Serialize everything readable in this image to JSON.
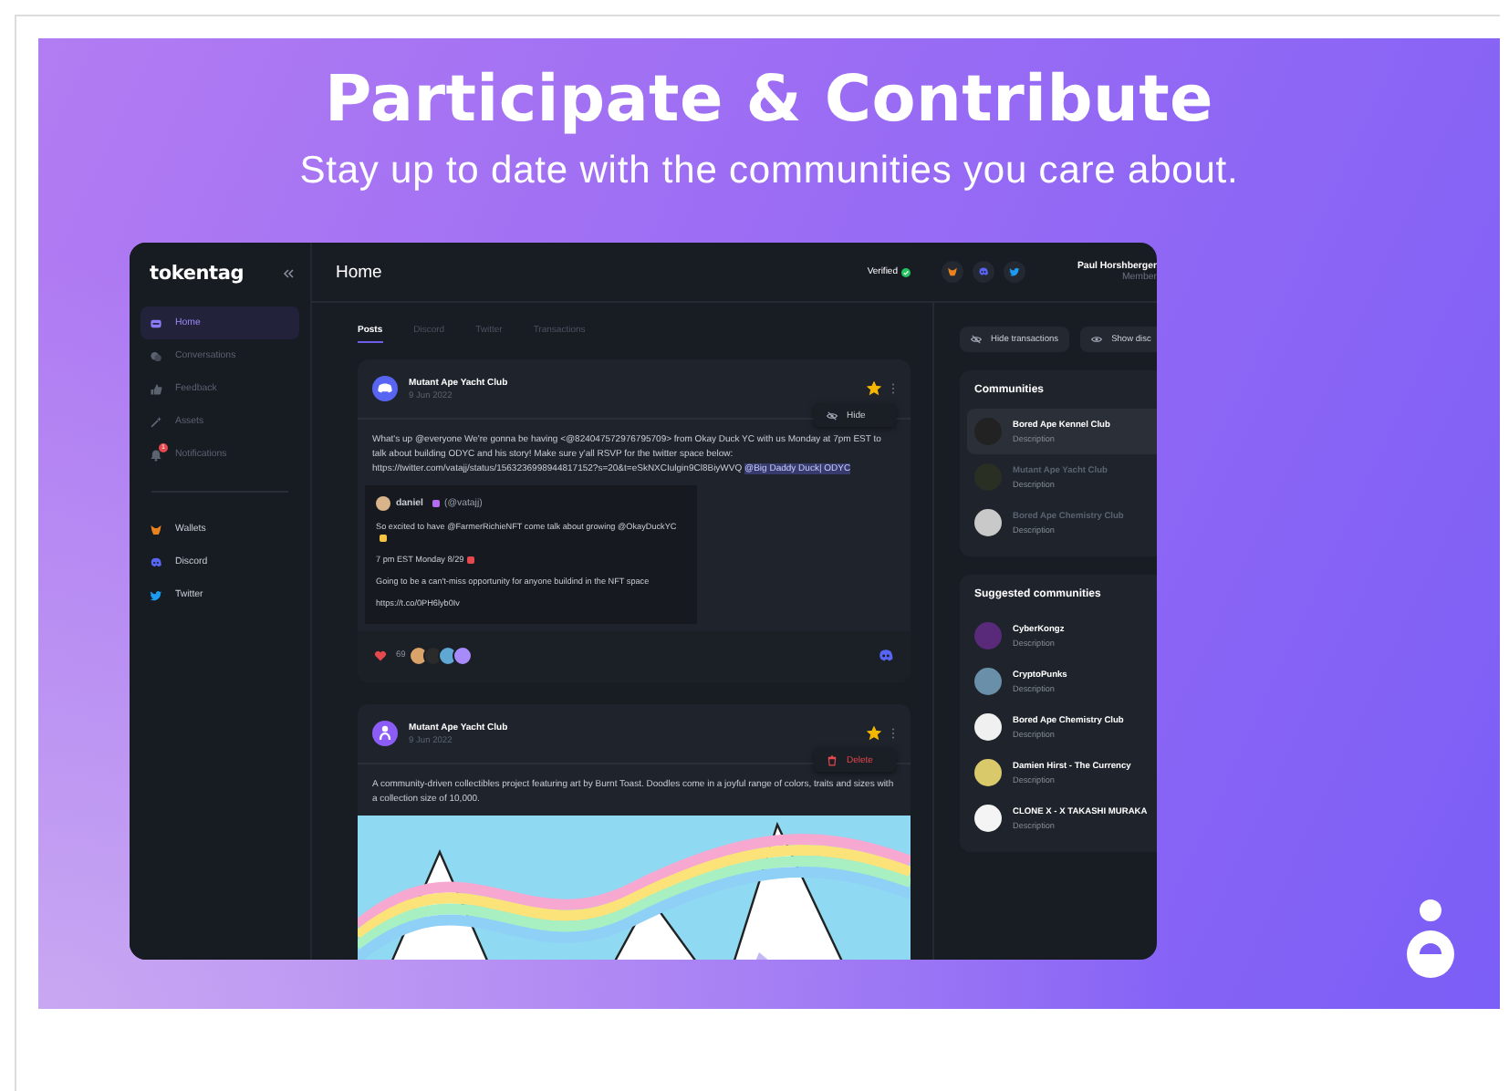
{
  "banner": {
    "title": "Participate & Contribute",
    "subtitle": "Stay up to date with the communities you care about."
  },
  "app": {
    "logo": "tokentag",
    "sidebar": {
      "items": [
        {
          "label": "Home",
          "kind": "window",
          "selected": true
        },
        {
          "label": "Conversations",
          "kind": "chat",
          "selected": false
        },
        {
          "label": "Feedback",
          "kind": "thumb",
          "selected": false
        },
        {
          "label": "Assets",
          "kind": "wand",
          "selected": false
        },
        {
          "label": "Notifications",
          "kind": "bell",
          "selected": false,
          "badge": "1"
        }
      ],
      "links": [
        {
          "label": "Wallets",
          "kind": "fox"
        },
        {
          "label": "Discord",
          "kind": "discord"
        },
        {
          "label": "Twitter",
          "kind": "bird"
        }
      ]
    },
    "header": {
      "title": "Home",
      "status": "Verified",
      "buttons": [
        {
          "kind": "fox"
        },
        {
          "kind": "discord"
        },
        {
          "kind": "bird"
        }
      ],
      "user_name": "Paul Horshberger",
      "user_role": "Member"
    },
    "tabs": [
      {
        "label": "Posts",
        "selected": true
      },
      {
        "label": "Discord",
        "selected": false
      },
      {
        "label": "Twitter",
        "selected": false
      },
      {
        "label": "Transactions",
        "selected": false
      }
    ],
    "posts": [
      {
        "kind": "discord",
        "author": "Mutant Ape Yacht Club",
        "date": "9 Jun 2022",
        "starred": true,
        "menu": {
          "kind": "hide",
          "label": "Hide"
        },
        "text": "What's up @everyone We're gonna be having <@824047572976795709> from Okay Duck YC with us Monday at 7pm EST to talk about building ODYC and his story! Make sure y'all RSVP for the twitter space below: https://twitter.com/vatajj/status/1563236998944817152?s=20&t=eSkNXCIulgin9Cl8BiyWVQ",
        "mention": "@Big Daddy Duck| ODYC",
        "embed": {
          "author": "daniel",
          "handle": "(@vatajj)",
          "lines": [
            "So excited to have @FarmerRichieNFT come talk about growing @OkayDuckYC",
            "7 pm EST Monday 8/29",
            "Going to be a can't-miss opportunity for anyone buildind in the NFT space",
            "https://t.co/0PH6lyb0Iv"
          ]
        },
        "likes": "69"
      },
      {
        "kind": "figure",
        "author": "Mutant Ape Yacht Club",
        "date": "9 Jun 2022",
        "starred": true,
        "menu": {
          "kind": "delete",
          "label": "Delete"
        },
        "text": "A community-driven collectibles project featuring art by Burnt Toast. Doodles come in a joyful range of colors, traits and sizes with a collection size of 10,000.",
        "image": true
      }
    ],
    "actions": [
      "Hide transactions",
      "Show disc"
    ],
    "communities": {
      "title": "Communities",
      "items": [
        {
          "name": "Bored Ape Kennel Club",
          "description": "Description",
          "selected": true
        },
        {
          "name": "Mutant Ape Yacht Club",
          "description": "Description",
          "selected": false
        },
        {
          "name": "Bored Ape Chemistry Club",
          "description": "Description",
          "selected": false
        }
      ]
    },
    "suggested": {
      "title": "Suggested communities",
      "items": [
        {
          "name": "CyberKongz",
          "description": "Description"
        },
        {
          "name": "CryptoPunks",
          "description": "Description"
        },
        {
          "name": "Bored Ape Chemistry Club",
          "description": "Description"
        },
        {
          "name": "Damien Hirst - The Currency",
          "description": "Description"
        },
        {
          "name": "CLONE X - X TAKASHI MURAKA",
          "description": "Description"
        }
      ]
    }
  }
}
